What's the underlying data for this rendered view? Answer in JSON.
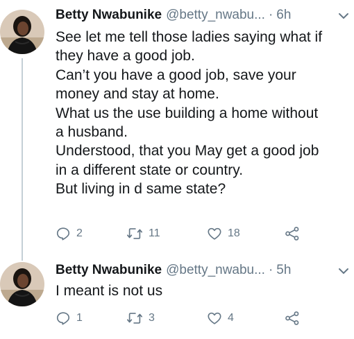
{
  "tweets": [
    {
      "author_name": "Betty Nwabunike",
      "handle": "@betty_nwabu...",
      "time": "6h",
      "lines": [
        "See let me tell those ladies saying what if",
        "they have a good job.",
        "Can’t you  have a good job, save your",
        "money and stay at home.",
        "What us the use building a home without",
        "a husband.",
        "Understood, that you May get a good job",
        "in a different state or country.",
        "But living in d same state?"
      ],
      "replies": "2",
      "retweets": "11",
      "likes": "18"
    },
    {
      "author_name": "Betty Nwabunike",
      "handle": "@betty_nwabu...",
      "time": "5h",
      "lines": [
        "I meant is not us"
      ],
      "replies": "1",
      "retweets": "3",
      "likes": "4"
    }
  ],
  "separator": "·",
  "icons": {
    "reply": "reply-icon",
    "retweet": "retweet-icon",
    "like": "heart-icon",
    "share": "share-icon",
    "menu": "chevron-down-icon"
  },
  "colors": {
    "muted": "#657786",
    "text": "#14171a",
    "thread": "#c4cfd6"
  }
}
